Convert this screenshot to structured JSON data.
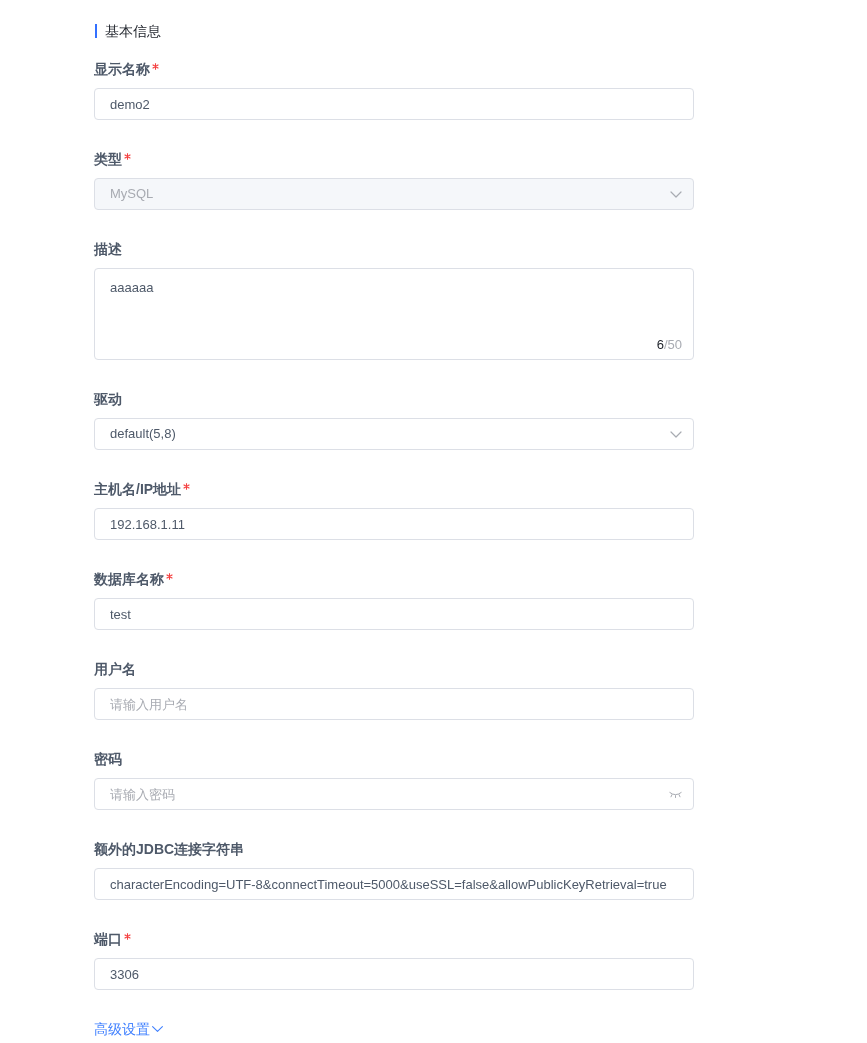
{
  "section": {
    "title": "基本信息"
  },
  "fields": [
    {
      "kind": "text",
      "label": "显示名称",
      "required": true,
      "disabled": false,
      "value": "demo2"
    },
    {
      "kind": "select",
      "label": "类型",
      "required": true,
      "disabled": true,
      "value": "MySQL"
    },
    {
      "kind": "textarea",
      "label": "描述",
      "required": false,
      "disabled": false,
      "value": "aaaaaa",
      "count": "6",
      "limit": "/50"
    },
    {
      "kind": "select",
      "label": "驱动",
      "required": false,
      "disabled": false,
      "value": "default(5,8)"
    },
    {
      "kind": "text",
      "label": "主机名/IP地址",
      "required": true,
      "disabled": false,
      "value": "192.168.1.11"
    },
    {
      "kind": "text",
      "label": "数据库名称",
      "required": true,
      "disabled": false,
      "value": "test"
    },
    {
      "kind": "text",
      "label": "用户名",
      "required": false,
      "disabled": false,
      "placeholder": "请输入用户名"
    },
    {
      "kind": "password",
      "label": "密码",
      "required": false,
      "disabled": false,
      "placeholder": "请输入密码"
    },
    {
      "kind": "text",
      "label": "额外的JDBC连接字符串",
      "required": false,
      "disabled": false,
      "value": "characterEncoding=UTF-8&connectTimeout=5000&useSSL=false&allowPublicKeyRetrieval=true"
    },
    {
      "kind": "text",
      "label": "端口",
      "required": true,
      "disabled": false,
      "value": "3306"
    }
  ],
  "advanced_link": {
    "label": "高级设置",
    "expanded": false
  }
}
